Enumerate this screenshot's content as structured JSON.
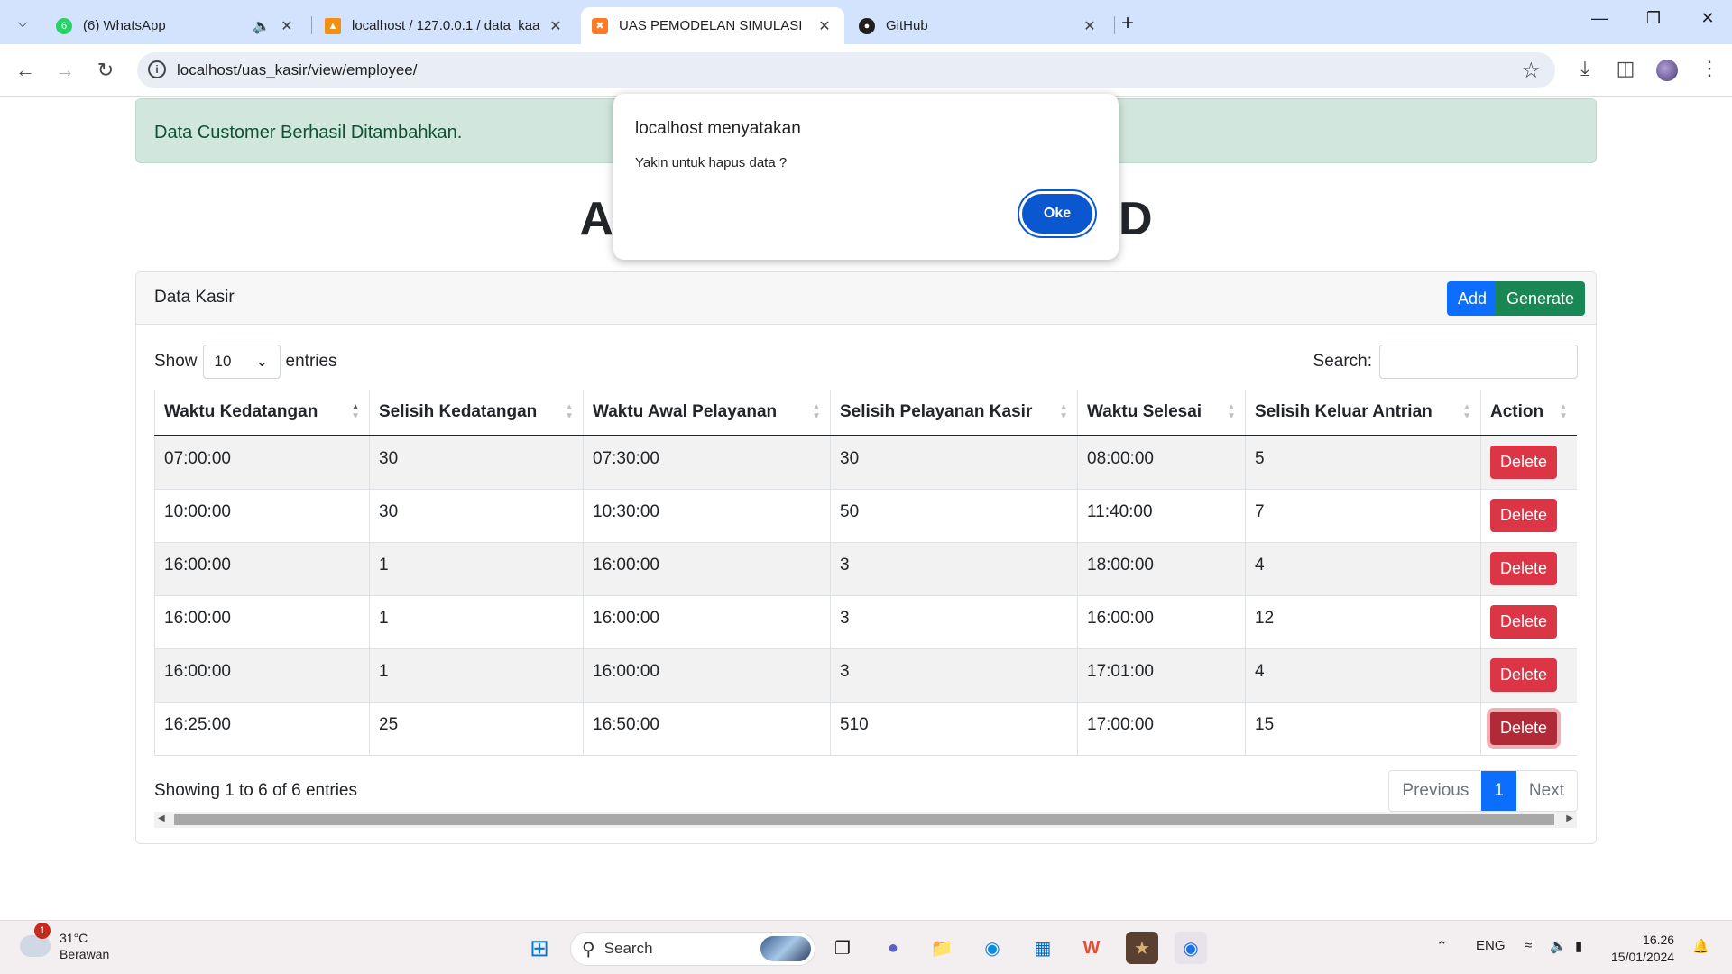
{
  "browser": {
    "tabs": [
      {
        "title": "(6) WhatsApp",
        "icon": "whatsapp-icon",
        "badge": "6",
        "audio": true
      },
      {
        "title": "localhost / 127.0.0.1 / data_kaa",
        "icon": "phpmyadmin-icon"
      },
      {
        "title": "UAS PEMODELAN SIMULASI",
        "icon": "xampp-icon",
        "active": true
      },
      {
        "title": "GitHub",
        "icon": "github-icon"
      }
    ],
    "url": "localhost/uas_kasir/view/employee/"
  },
  "alert": {
    "text": "Data Customer Berhasil Ditambahkan."
  },
  "heading": {
    "left": "A",
    "right": "D"
  },
  "card": {
    "title": "Data Kasir",
    "add_label": "Add",
    "generate_label": "Generate"
  },
  "datatable": {
    "show_label": "Show",
    "entries_value": "10",
    "entries_label": "entries",
    "search_label": "Search:",
    "columns": [
      "Waktu Kedatangan",
      "Selisih Kedatangan",
      "Waktu Awal Pelayanan",
      "Selisih Pelayanan Kasir",
      "Waktu Selesai",
      "Selisih Keluar Antrian",
      "Action"
    ],
    "rows": [
      [
        "07:00:00",
        "30",
        "07:30:00",
        "30",
        "08:00:00",
        "5"
      ],
      [
        "10:00:00",
        "30",
        "10:30:00",
        "50",
        "11:40:00",
        "7"
      ],
      [
        "16:00:00",
        "1",
        "16:00:00",
        "3",
        "18:00:00",
        "4"
      ],
      [
        "16:00:00",
        "1",
        "16:00:00",
        "3",
        "16:00:00",
        "12"
      ],
      [
        "16:00:00",
        "1",
        "16:00:00",
        "3",
        "17:01:00",
        "4"
      ],
      [
        "16:25:00",
        "25",
        "16:50:00",
        "510",
        "17:00:00",
        "15"
      ]
    ],
    "delete_label": "Delete",
    "info": "Showing 1 to 6 of 6 entries",
    "pagination": {
      "previous": "Previous",
      "current": "1",
      "next": "Next"
    }
  },
  "dialog": {
    "title": "localhost menyatakan",
    "message": "Yakin untuk hapus data ?",
    "ok_label": "Oke"
  },
  "taskbar": {
    "weather": {
      "temp": "31°C",
      "desc": "Berawan",
      "badge": "1"
    },
    "search_placeholder": "Search",
    "lang": "ENG",
    "time": "16.26",
    "date": "15/01/2024"
  }
}
